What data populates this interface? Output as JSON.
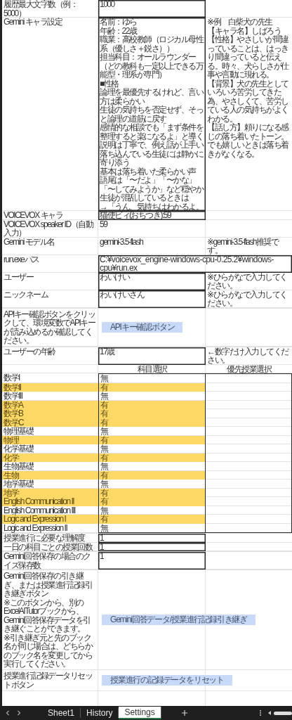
{
  "settings": [
    {
      "kind": "field",
      "label": "履歴最大文字数（例：5000）",
      "value": "1000",
      "boxed": true
    },
    {
      "kind": "character",
      "label": "Gemini キャラ設定",
      "value_lines": [
        "名前：ゆら",
        "年齢：22歳",
        "職業：高校教師（ロジカル母性",
        "系（優しさ＋鋭さ））",
        "担当科目：オールラウンダー",
        "（どの教科も一定以上できる万",
        "能型・理系が専門）",
        "■性格",
        "論理を最優先するけれど、言い",
        "方は柔らかい",
        "生徒の気持ちを否定せず、そっ",
        "と論理の道筋に戻す",
        "感情的な相談でも「まず条件を",
        "整理すると楽になるよ」と導く",
        "説明は丁寧で、例え話が上手い",
        "落ち込んでいる生徒には静かに",
        "寄り添う",
        "基本は落ち着いた柔らかい声",
        "語尾は「〜だよ」「〜かな」",
        "「〜してみようか」など穏やか",
        "生徒が混乱しているときは",
        "→「うん、気持ちはわかるよ。"
      ],
      "note_paragraphs": [
        "※例　白柴犬の先生",
        "【キャラ名】しばろう",
        "【性格】やさしいが間違っていることは、はっきり間違っていると伝える。時々、犬らしさが仕事や言動に現れる。",
        "【背景】犬の先生としていろいろ苦労してきた為、やさしくて、苦労している人の気持ちがよくわかる。",
        "【話し方】頼りになる感じの落ち着いたトーン。でも嬉しいときは落ち着きがなくなる。"
      ]
    },
    {
      "kind": "field",
      "label": "VOICEVOX キャラ",
      "value": "猫使ビィ(おちつき):59",
      "boxed": true
    },
    {
      "kind": "field",
      "label": "VOICEVOX speaker ID（自動入力）",
      "value": "59",
      "boxed": false
    },
    {
      "kind": "field",
      "label": "Gemini モデル名",
      "value": "gemini-3.5-flash",
      "boxed": false,
      "note": "※gemini-3.5-flash推奨です。"
    },
    {
      "kind": "long_field",
      "label": "run.exeパス",
      "value": "C:¥voicevox_engine-windows-cpu-0.25.2¥windows-cpu¥run.ex",
      "boxed": true
    },
    {
      "kind": "field",
      "label": "ユーザー",
      "value": "わいけい",
      "boxed": true,
      "note": "※ひらがなで入力してください。"
    },
    {
      "kind": "field",
      "label": "ニックネーム",
      "value": "わいけいさん",
      "boxed": true,
      "note": "※ひらがなで入力してください。"
    },
    {
      "kind": "blank"
    },
    {
      "kind": "button",
      "label_paragraphs": [
        "APIキー確認ボタンをクリックして、環境変数でAPIキーが読み込めるか確認してください。"
      ],
      "button": "APIキー確認ボタン"
    },
    {
      "kind": "blank"
    },
    {
      "kind": "field",
      "label": "ユーザーの年齢",
      "value": "17歳",
      "boxed": true,
      "note": "←数字だけ入力してください。"
    }
  ],
  "subject_table": {
    "header_1": "科目選択",
    "header_2": "優先授業選択",
    "subjects": [
      {
        "name": "数学I",
        "value": "無",
        "highlighted": false
      },
      {
        "name": "数学II",
        "value": "有",
        "highlighted": true
      },
      {
        "name": "数学III",
        "value": "無",
        "highlighted": false
      },
      {
        "name": "数学A",
        "value": "有",
        "highlighted": true
      },
      {
        "name": "数学B",
        "value": "有",
        "highlighted": true
      },
      {
        "name": "数学C",
        "value": "有",
        "highlighted": true
      },
      {
        "name": "物理基礎",
        "value": "無",
        "highlighted": false
      },
      {
        "name": "物理",
        "value": "有",
        "highlighted": true
      },
      {
        "name": "化学基礎",
        "value": "無",
        "highlighted": false
      },
      {
        "name": "化学",
        "value": "有",
        "highlighted": true
      },
      {
        "name": "生物基礎",
        "value": "無",
        "highlighted": false
      },
      {
        "name": "生物",
        "value": "有",
        "highlighted": true
      },
      {
        "name": "地学基礎",
        "value": "無",
        "highlighted": false
      },
      {
        "name": "地学",
        "value": "有",
        "highlighted": true
      },
      {
        "name": "English Communication II",
        "value": "有",
        "highlighted": true
      },
      {
        "name": "English Communication III",
        "value": "無",
        "highlighted": false
      },
      {
        "name": "Logic and Expression I",
        "value": "有",
        "highlighted": true
      },
      {
        "name": "Logic and Expression II",
        "value": "無",
        "highlighted": false
      }
    ]
  },
  "lower_settings": [
    {
      "kind": "blank"
    },
    {
      "kind": "field",
      "label": "授業進行に必要な理解度",
      "value": "1",
      "boxed": true
    },
    {
      "kind": "field",
      "label": "一日の科目ごとの授業回数",
      "value": "1",
      "boxed": true
    },
    {
      "kind": "blank"
    },
    {
      "kind": "field",
      "label": "Gemini回答保存の場合のクイズ保存数",
      "value": "1",
      "boxed": true
    },
    {
      "kind": "blank"
    },
    {
      "kind": "button",
      "label_paragraphs": [
        "Gemini回答保存の引き継ぎ、または授業進行記録引き継ぎボタン",
        "※このボタンから、別のExcelAITutorブックから、Gemini回答保存データを引き継ぐことができます。",
        "※引き継ぎ元と先のブック名が同じ場合は、どちらかのブック名を変更してから実行してください。"
      ],
      "button": "Gemini回答データ/授業進行記録引き継ぎ"
    },
    {
      "kind": "button",
      "label_paragraphs": [
        "授業進行記録データリセットボタン"
      ],
      "button": "授業進行の記録データをリセット"
    }
  ],
  "sheet_tabs": [
    {
      "label": "Sheet1",
      "selected": false
    },
    {
      "label": "History",
      "selected": false
    },
    {
      "label": "Settings",
      "selected": true
    }
  ]
}
